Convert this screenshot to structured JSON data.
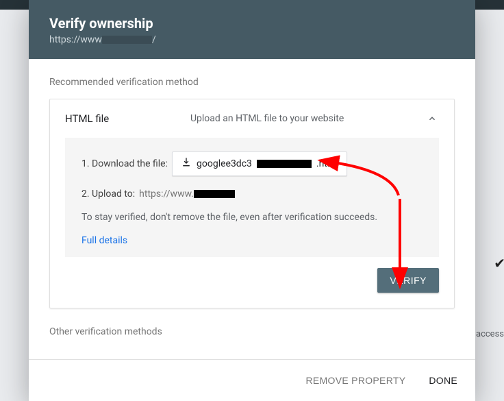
{
  "header": {
    "title": "Verify ownership",
    "url_prefix": "https://www",
    "url_suffix": "/"
  },
  "sections": {
    "recommended_label": "Recommended verification method",
    "other_label": "Other verification methods"
  },
  "card": {
    "title": "HTML file",
    "subtitle": "Upload an HTML file to your website",
    "step1_prefix": "1. Download the file:",
    "download_prefix": "googlee3dc3",
    "download_suffix": ".html",
    "step2_prefix": "2. Upload to:",
    "upload_url_prefix": "https://www.",
    "note": "To stay verified, don't remove the file, even after verification succeeds.",
    "full_details": "Full details",
    "verify": "VERIFY"
  },
  "footer": {
    "remove": "REMOVE PROPERTY",
    "done": "DONE"
  },
  "background_peek": "access"
}
